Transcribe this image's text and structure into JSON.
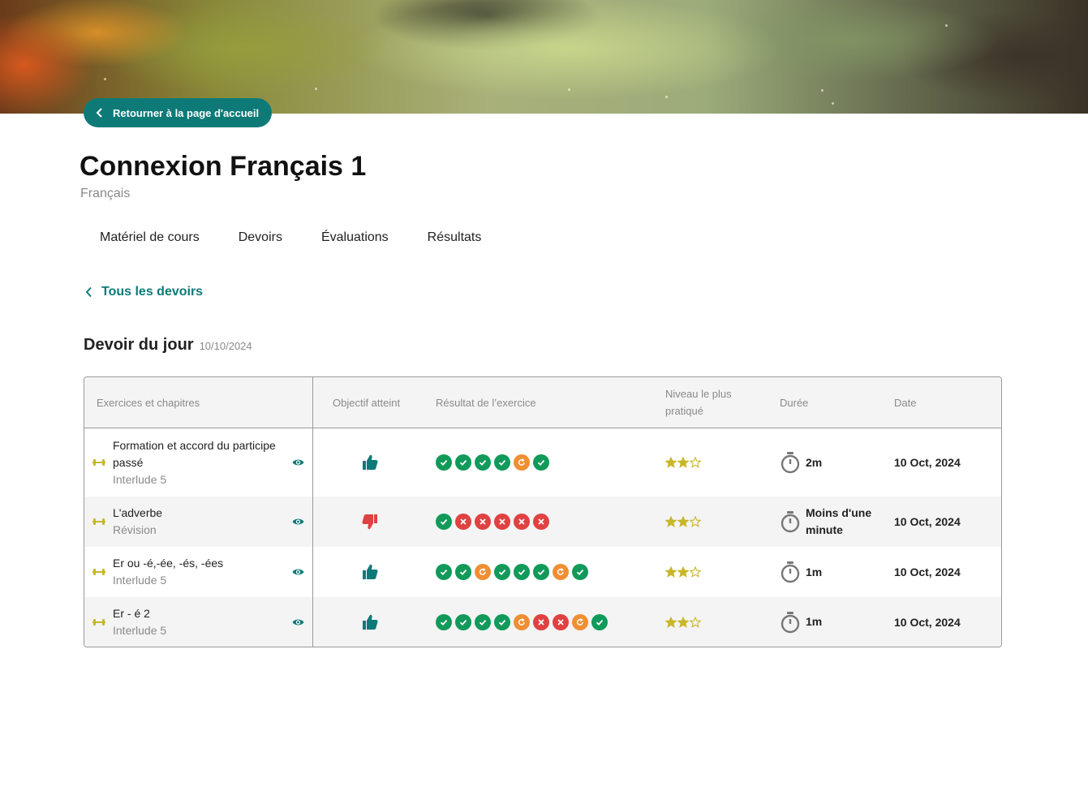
{
  "header": {
    "back_home_label": "Retourner à la page d'accueil",
    "course_title": "Connexion Français 1",
    "subject": "Français"
  },
  "tabs": [
    {
      "label": "Matériel de cours"
    },
    {
      "label": "Devoirs"
    },
    {
      "label": "Évaluations"
    },
    {
      "label": "Résultats"
    }
  ],
  "back_link": {
    "label": "Tous les devoirs"
  },
  "assignment": {
    "title": "Devoir du jour",
    "date": "10/10/2024"
  },
  "table": {
    "columns": {
      "exercises": "Exercices et chapitres",
      "goal": "Objectif atteint",
      "result": "Résultat de l’exercice",
      "level": "Niveau le plus pratiqué",
      "duration": "Durée",
      "date": "Date"
    },
    "rows": [
      {
        "name": "Formation et accord du participe passé",
        "chapter": "Interlude 5",
        "goal_met": true,
        "results": [
          "ok",
          "ok",
          "ok",
          "ok",
          "retry",
          "ok"
        ],
        "level_stars": 2,
        "level_max": 3,
        "duration": "2m",
        "date": "10 Oct, 2024"
      },
      {
        "name": "L'adverbe",
        "chapter": "Révision",
        "goal_met": false,
        "results": [
          "ok",
          "ko",
          "ko",
          "ko",
          "ko",
          "ko"
        ],
        "level_stars": 2,
        "level_max": 3,
        "duration": "Moins d'une minute",
        "date": "10 Oct, 2024"
      },
      {
        "name": "Er ou -é,-ée, -és, -ées",
        "chapter": "Interlude 5",
        "goal_met": true,
        "results": [
          "ok",
          "ok",
          "retry",
          "ok",
          "ok",
          "ok",
          "retry",
          "ok"
        ],
        "level_stars": 2,
        "level_max": 3,
        "duration": "1m",
        "date": "10 Oct, 2024"
      },
      {
        "name": "Er - é 2",
        "chapter": "Interlude 5",
        "goal_met": true,
        "results": [
          "ok",
          "ok",
          "ok",
          "ok",
          "retry",
          "ko",
          "ko",
          "retry",
          "ok"
        ],
        "level_stars": 2,
        "level_max": 3,
        "duration": "1m",
        "date": "10 Oct, 2024"
      }
    ]
  },
  "colors": {
    "accent": "#0d7a78",
    "success": "#119a5a",
    "error": "#e04141",
    "retry": "#ef8f33",
    "star": "#c8b72a"
  },
  "icons": {
    "home_button": "chevron-left-icon",
    "exercise": "dumbbell-icon",
    "preview": "eye-icon",
    "goal_yes": "thumbs-up-icon",
    "goal_no": "thumbs-down-icon",
    "duration": "stopwatch-icon"
  }
}
